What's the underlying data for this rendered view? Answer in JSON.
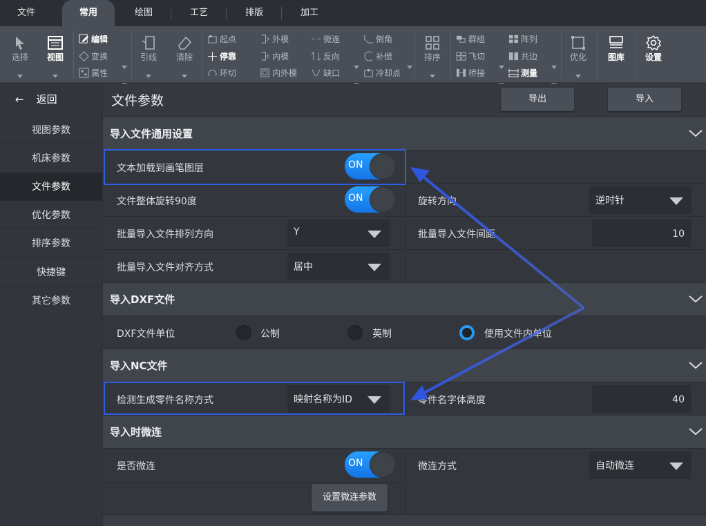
{
  "menu": {
    "tabs": [
      "文件",
      "常用",
      "绘图",
      "工艺",
      "排版",
      "加工"
    ],
    "active": "常用"
  },
  "ribbon": {
    "select": "选择",
    "view": "视图",
    "edit": "编辑",
    "transform": "变换",
    "props": "属性",
    "leadline": "引线",
    "clear": "清除",
    "startpoint": "起点",
    "stop": "停靠",
    "loopcut": "环切",
    "outer": "外模",
    "inner": "内模",
    "inout": "内外模",
    "microjoint": "微连",
    "reverse": "反向",
    "gap": "缺口",
    "chamfer": "倒角",
    "compensate": "补偿",
    "coolpoint": "冷却点",
    "sort": "排序",
    "group": "群组",
    "flycut": "飞切",
    "bridge": "桥接",
    "array": "阵列",
    "commonedge": "共边",
    "measure": "测量",
    "optimize": "优化",
    "library": "图库",
    "settings": "设置"
  },
  "sidebar": {
    "back": "返回",
    "items": [
      "视图参数",
      "机床参数",
      "文件参数",
      "优化参数",
      "排序参数",
      "快捷键",
      "其它参数"
    ],
    "active": "文件参数"
  },
  "page": {
    "title": "文件参数",
    "export": "导出",
    "import": "导入"
  },
  "sections": {
    "general": {
      "title": "导入文件通用设置",
      "text_to_pen_layer": {
        "label": "文本加载到画笔图层",
        "state": "ON"
      },
      "rotate90": {
        "label": "文件整体旋转90度",
        "state": "ON"
      },
      "rotate_dir": {
        "label": "旋转方向",
        "value": "逆时针"
      },
      "batch_dir": {
        "label": "批量导入文件排列方向",
        "value": "Y"
      },
      "batch_spacing": {
        "label": "批量导入文件间距",
        "value": "10"
      },
      "batch_align": {
        "label": "批量导入文件对齐方式",
        "value": "居中"
      }
    },
    "dxf": {
      "title": "导入DXF文件",
      "unit_label": "DXF文件单位",
      "options": [
        "公制",
        "英制",
        "使用文件内单位"
      ],
      "selected": "使用文件内单位"
    },
    "nc": {
      "title": "导入NC文件",
      "part_name_mode": {
        "label": "检测生成零件名称方式",
        "value": "映射名称为ID"
      },
      "part_font_height": {
        "label": "零件名字体高度",
        "value": "40"
      }
    },
    "microjoint": {
      "title": "导入时微连",
      "enable": {
        "label": "是否微连",
        "state": "ON"
      },
      "method": {
        "label": "微连方式",
        "value": "自动微连"
      },
      "params_button": "设置微连参数"
    }
  },
  "colors": {
    "accent": "#1e8cf5",
    "highlight": "#2f5ee6",
    "background": "#3a3e45"
  }
}
